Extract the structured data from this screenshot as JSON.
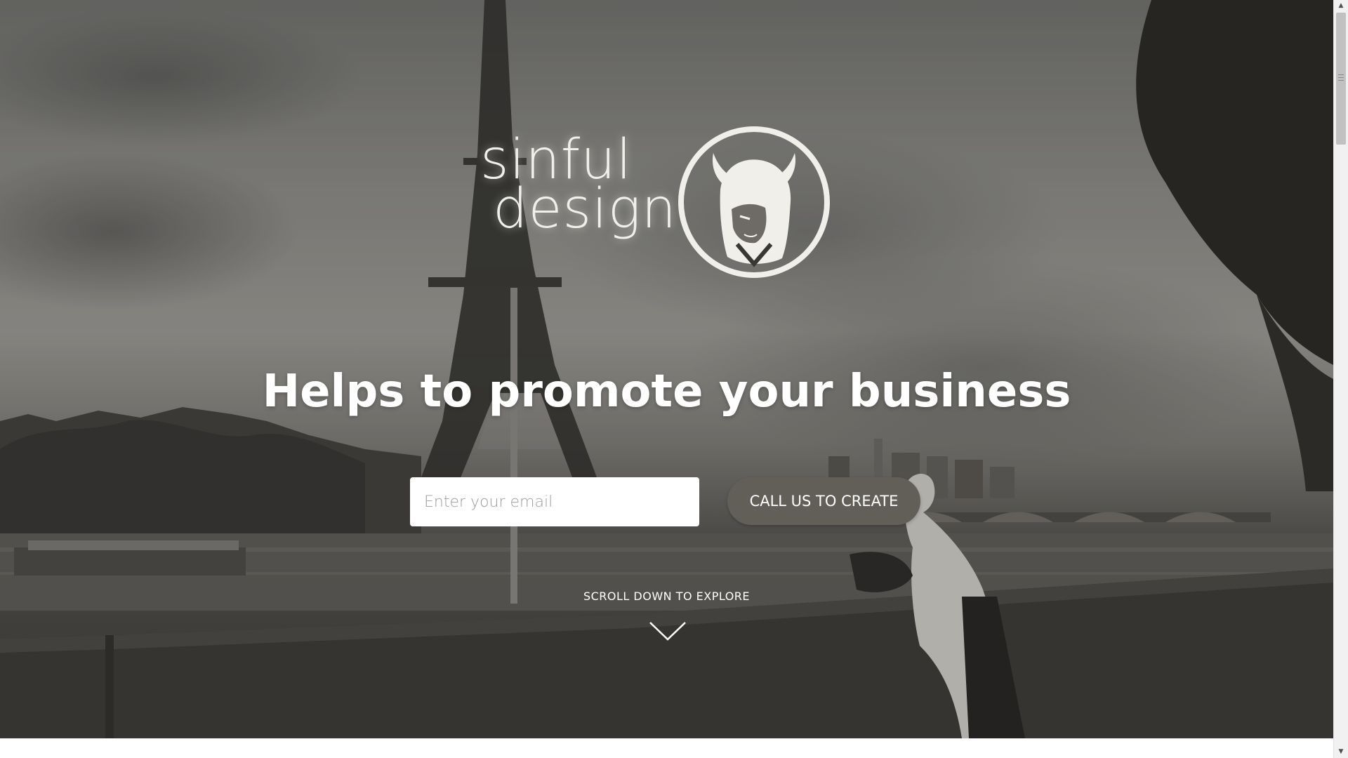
{
  "brand": {
    "logo_line1": "sinful",
    "logo_line2": "design",
    "logo_icon": "devil-girl-emblem-icon"
  },
  "hero": {
    "headline": "Helps to promote your business",
    "background": "black-and-white photo of Eiffel Tower and river Seine"
  },
  "signup": {
    "email_placeholder": "Enter your email",
    "cta_label": "CALL US TO CREATE"
  },
  "scroll": {
    "label": "SCROLL DOWN TO EXPLORE",
    "icon": "chevron-down-icon"
  },
  "colors": {
    "cta_background": "#625e58",
    "text": "#ffffff",
    "input_background": "#ffffff"
  }
}
